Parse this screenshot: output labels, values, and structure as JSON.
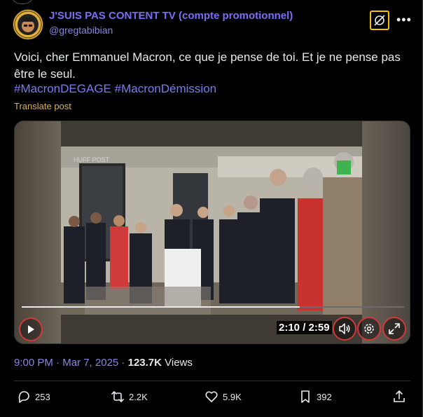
{
  "author": {
    "name": "J'SUIS PAS CONTENT TV (compte promotionnel)",
    "handle": "@gregtabibian"
  },
  "tweet": {
    "text": "Voici, cher Emmanuel Macron, ce que je pense de toi. Et je ne pense pas être le seul.",
    "hashtags": [
      "#MacronDEGAGE",
      "#MacronDémission"
    ],
    "translate_label": "Translate post"
  },
  "video": {
    "time_display": "2:10 / 2:59",
    "progress": 0.727,
    "watermark": "HUFF POST"
  },
  "meta": {
    "time": "9:00 PM",
    "separator1": " · ",
    "date": "Mar 7, 2025",
    "separator2": " · ",
    "views_count": "123.7K",
    "views_label": " Views"
  },
  "actions": {
    "replies": "253",
    "reposts": "2.2K",
    "likes": "5.9K",
    "bookmarks": "392"
  },
  "colors": {
    "accent_name": "#7f6cf4",
    "hashtag": "#7a7cf0",
    "translate": "#d8b54a",
    "control_ring": "#d13a3a",
    "grok_border": "#f7c200"
  },
  "icons": [
    "grok-icon",
    "more-icon",
    "play-icon",
    "volume-icon",
    "settings-icon",
    "fullscreen-icon",
    "reply-icon",
    "repost-icon",
    "like-icon",
    "bookmark-icon",
    "share-icon"
  ]
}
